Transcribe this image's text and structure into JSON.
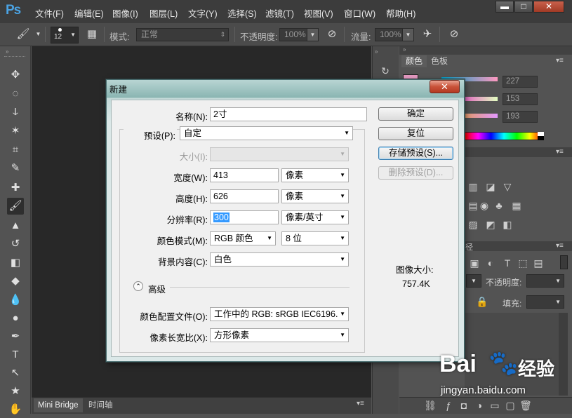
{
  "app": {
    "logo": "Ps"
  },
  "menu": [
    "文件(F)",
    "编辑(E)",
    "图像(I)",
    "图层(L)",
    "文字(Y)",
    "选择(S)",
    "滤镜(T)",
    "视图(V)",
    "窗口(W)",
    "帮助(H)"
  ],
  "window_controls": {
    "minimize": "▬",
    "maximize": "□",
    "close": "✕"
  },
  "options_bar": {
    "brush_size": "12",
    "mode_label": "模式:",
    "mode_value": "正常",
    "opacity_label": "不透明度:",
    "opacity_value": "100%",
    "flow_label": "流量:",
    "flow_value": "100%"
  },
  "tools": [
    "move-tool",
    "marquee-tool",
    "lasso-tool",
    "magic-wand-tool",
    "crop-tool",
    "eyedropper-tool",
    "healing-tool",
    "brush-tool",
    "stamp-tool",
    "history-brush-tool",
    "eraser-tool",
    "paint-bucket-tool",
    "blur-tool",
    "dodge-tool",
    "pen-tool",
    "type-tool",
    "path-select-tool",
    "shape-tool",
    "hand-tool"
  ],
  "tool_glyphs": [
    "✥",
    "◌",
    "ↆ",
    "✶",
    "⌗",
    "✎",
    "✚",
    "🖌",
    "▲",
    "↺",
    "◧",
    "◆",
    "💧",
    "●",
    "✒",
    "T",
    "↖",
    "★",
    "✋"
  ],
  "doc_tabs": [
    "Mini Bridge",
    "时间轴"
  ],
  "color_panel": {
    "tabs": [
      "颜色",
      "色板"
    ],
    "values": [
      "227",
      "153",
      "193"
    ]
  },
  "layers_panel": {
    "opacity_label": "不透明度:",
    "fill_label": "填充:"
  },
  "dialog": {
    "title": "新建",
    "close": "✕",
    "fields": {
      "name": {
        "label": "名称(N):",
        "value": "2寸"
      },
      "preset": {
        "label": "预设(P):",
        "value": "自定"
      },
      "size": {
        "label": "大小(I):",
        "value": ""
      },
      "width": {
        "label": "宽度(W):",
        "value": "413",
        "unit": "像素"
      },
      "height": {
        "label": "高度(H):",
        "value": "626",
        "unit": "像素"
      },
      "resolution": {
        "label": "分辨率(R):",
        "value": "300",
        "unit": "像素/英寸"
      },
      "color_mode": {
        "label": "颜色模式(M):",
        "value": "RGB 颜色",
        "depth": "8 位"
      },
      "background": {
        "label": "背景内容(C):",
        "value": "白色"
      },
      "advanced": {
        "label": "高级",
        "toggle": "⌃"
      },
      "color_profile": {
        "label": "颜色配置文件(O):",
        "value": "工作中的 RGB: sRGB IEC6196..."
      },
      "pixel_aspect": {
        "label": "像素长宽比(X):",
        "value": "方形像素"
      }
    },
    "buttons": {
      "ok": "确定",
      "reset": "复位",
      "save_preset": "存储预设(S)...",
      "delete_preset": "删除预设(D)..."
    },
    "image_size": {
      "label": "图像大小:",
      "value": "757.4K"
    }
  },
  "watermark": {
    "brand": "Bai",
    "brand2": "经验",
    "url": "jingyan.baidu.com"
  }
}
